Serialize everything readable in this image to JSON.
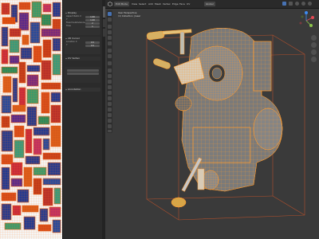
{
  "sidebar": {
    "view_panel": {
      "title": "Display",
      "rows": [
        {
          "label": "Aspect Ratio X",
          "value": "1.00"
        },
        {
          "label": "Y",
          "value": "1.00"
        },
        {
          "label": "Fixed Subdivisions",
          "value": "2"
        },
        {
          "label": "Tiles",
          "value": "1"
        }
      ]
    },
    "cursor_panel": {
      "title": "2D Cursor",
      "rows": [
        {
          "label": "Location X",
          "value": "0.5"
        },
        {
          "label": "Y",
          "value": "0.5"
        },
        {
          "label": "Pivot",
          "value": ""
        },
        {
          "label": "",
          "value": ""
        }
      ]
    },
    "annotation_label": "Annotation",
    "uv_vertex_label": "UV Vertex",
    "tabs": [
      "View",
      "Image",
      "Tool"
    ],
    "bottom_panel": "Annotation"
  },
  "viewport": {
    "header": {
      "editor_icon": "cube-icon",
      "mode": "Edit Mode",
      "menus": [
        "View",
        "Select",
        "Add",
        "Mesh",
        "Vertex",
        "Edge",
        "Face",
        "UV"
      ],
      "transform": "Global"
    },
    "info_lines": [
      "User Perspective",
      "(1) Collection | Gear"
    ],
    "gizmo": {
      "x_color": "#e24a55",
      "y_color": "#8bc34a",
      "z_color": "#3d8bf2"
    }
  },
  "colors": {
    "accent": "#4772b3",
    "wire_selected": "#ff9b2e",
    "bounding_box": "#b3502c"
  }
}
